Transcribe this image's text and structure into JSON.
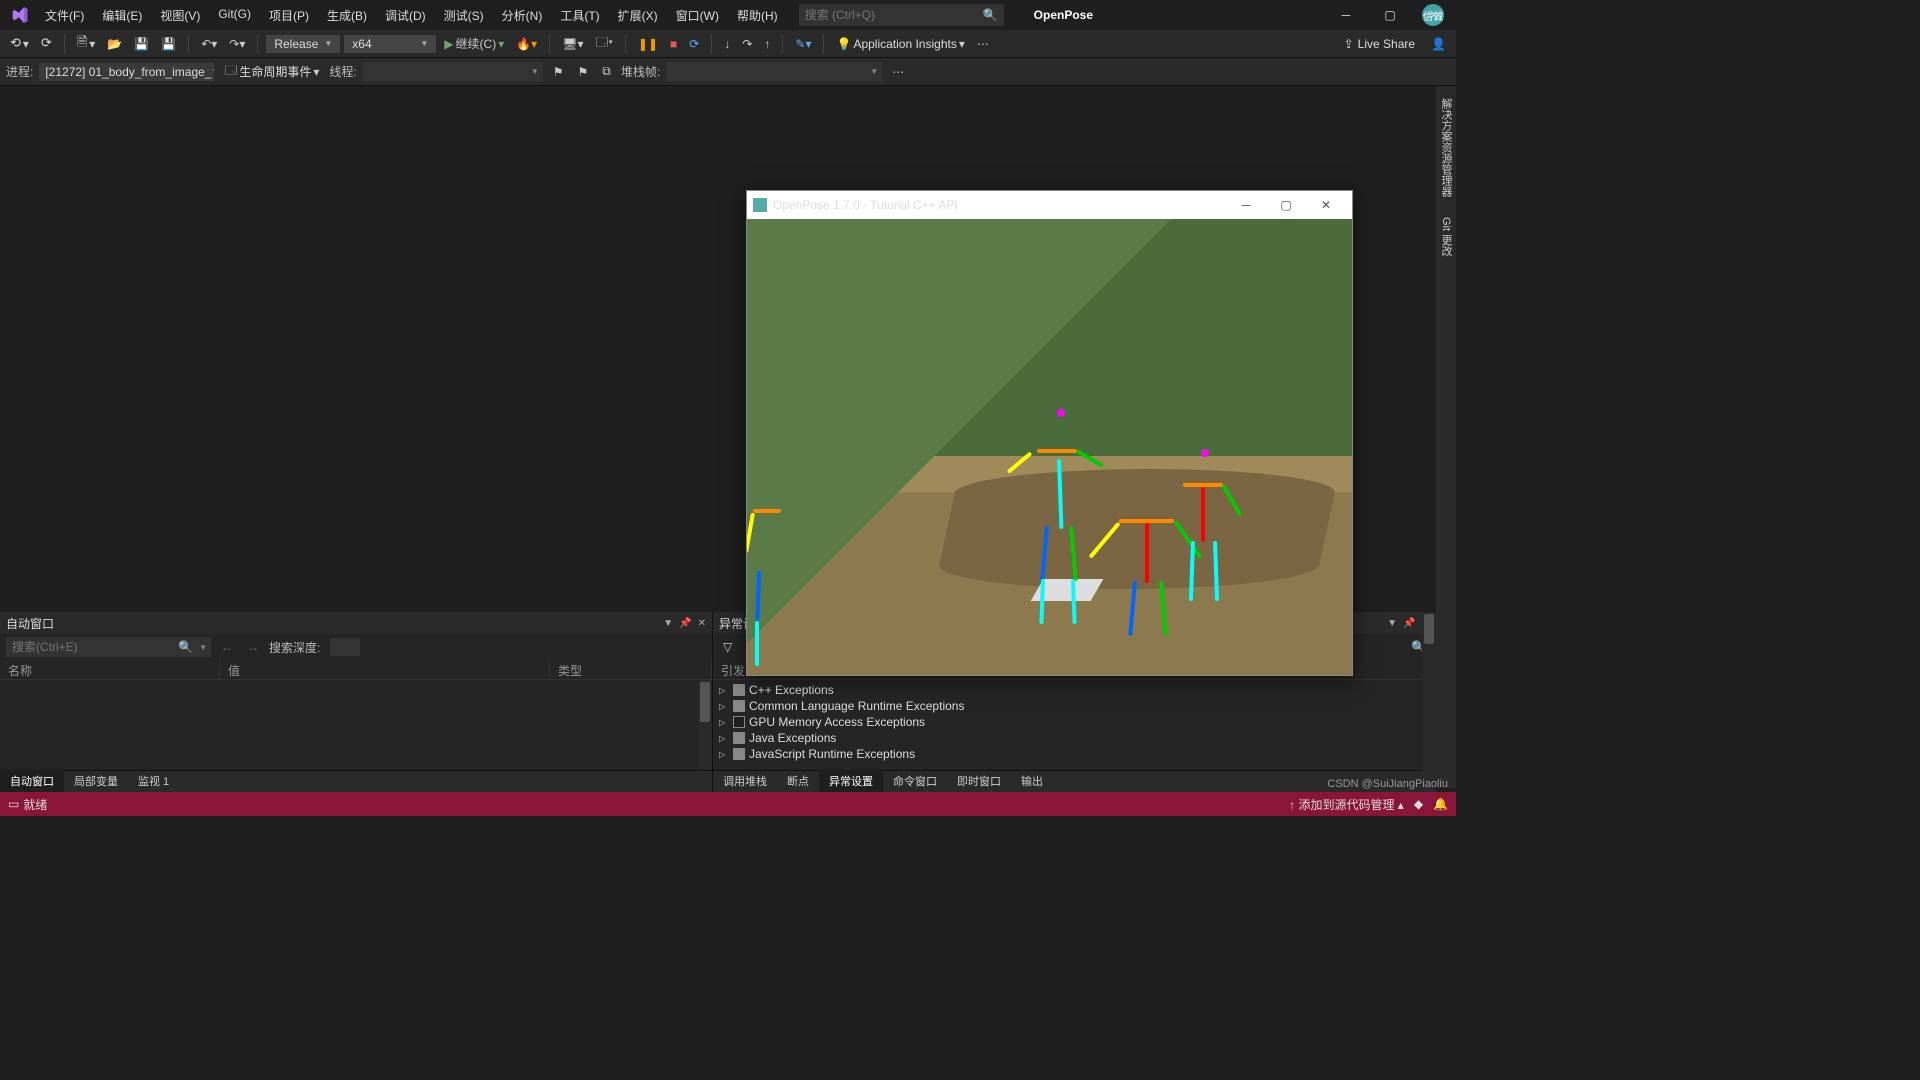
{
  "titlebar": {
    "menu": [
      "文件(F)",
      "编辑(E)",
      "视图(V)",
      "Git(G)",
      "项目(P)",
      "生成(B)",
      "调试(D)",
      "测试(S)",
      "分析(N)",
      "工具(T)",
      "扩展(X)",
      "窗口(W)",
      "帮助(H)"
    ],
    "search_placeholder": "搜索 (Ctrl+Q)",
    "appname": "OpenPose",
    "avatar": "信诚"
  },
  "toolbar": {
    "config": "Release",
    "platform": "x64",
    "continue": "继续(C)",
    "insights": "Application Insights",
    "liveshare": "Live Share"
  },
  "toolbar2": {
    "process_lbl": "进程:",
    "process_val": "[21272] 01_body_from_image_",
    "lifecycle": "生命周期事件",
    "thread_lbl": "线程:",
    "stack_lbl": "堆栈帧:"
  },
  "sidetabs": [
    "解决方案资源管理器",
    "Git 更改"
  ],
  "autos": {
    "title": "自动窗口",
    "search_placeholder": "搜索(Ctrl+E)",
    "depth_lbl": "搜索深度:",
    "cols": [
      "名称",
      "值",
      "类型"
    ],
    "tabs": [
      "自动窗口",
      "局部变量",
      "监视 1"
    ],
    "active_tab": 0
  },
  "exceptions": {
    "title": "异常设",
    "triggercol": "引发",
    "items": [
      {
        "label": "C++ Exceptions",
        "state": "ind"
      },
      {
        "label": "Common Language Runtime Exceptions",
        "state": "ind"
      },
      {
        "label": "GPU Memory Access Exceptions",
        "state": "off"
      },
      {
        "label": "Java Exceptions",
        "state": "ind"
      },
      {
        "label": "JavaScript Runtime Exceptions",
        "state": "ind"
      }
    ],
    "tabs": [
      "调用堆栈",
      "断点",
      "异常设置",
      "命令窗口",
      "即时窗口",
      "输出"
    ],
    "active_tab": 2
  },
  "appwin": {
    "title": "OpenPose 1.7.0 - Tutorial C++ API"
  },
  "status": {
    "ready": "就绪",
    "addsrc": "添加到源代码管理",
    "watermark": "CSDN @SuiJiangPiaoliu"
  }
}
